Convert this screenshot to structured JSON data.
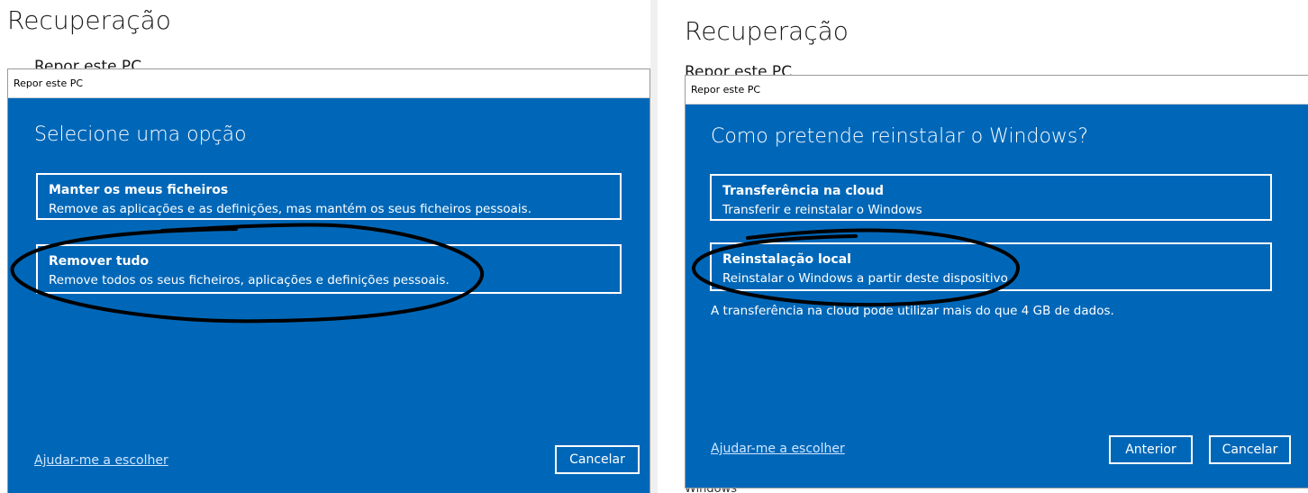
{
  "left": {
    "bg_title": "Recuperação",
    "bg_subtitle": "Repor este PC",
    "dialog_title": "Repor este PC",
    "heading": "Selecione uma opção",
    "options": [
      {
        "title": "Manter os meus ficheiros",
        "desc": "Remove as aplicações e as definições, mas mantém os seus ficheiros pessoais."
      },
      {
        "title": "Remover tudo",
        "desc": "Remove todos os seus ficheiros, aplicações e definições pessoais."
      }
    ],
    "help_link": "Ajudar-me a escolher",
    "cancel": "Cancelar"
  },
  "right": {
    "bg_title": "Recuperação",
    "bg_subtitle": "Repor este PC",
    "bg_bottom": "Windows",
    "dialog_title": "Repor este PC",
    "heading": "Como pretende reinstalar o Windows?",
    "options": [
      {
        "title": "Transferência na cloud",
        "desc": "Transferir e reinstalar o Windows"
      },
      {
        "title": "Reinstalação local",
        "desc": "Reinstalar o Windows a partir deste dispositivo"
      }
    ],
    "note": "A transferência na cloud pode utilizar mais do que 4 GB de dados.",
    "help_link": "Ajudar-me a escolher",
    "back": "Anterior",
    "cancel": "Cancelar"
  },
  "colors": {
    "dialog_blue": "#0067b8",
    "annotation": "#000000"
  },
  "annotations": [
    "hand-drawn-ellipse-around-remover-tudo",
    "hand-drawn-ellipse-around-reinstalacao-local"
  ]
}
